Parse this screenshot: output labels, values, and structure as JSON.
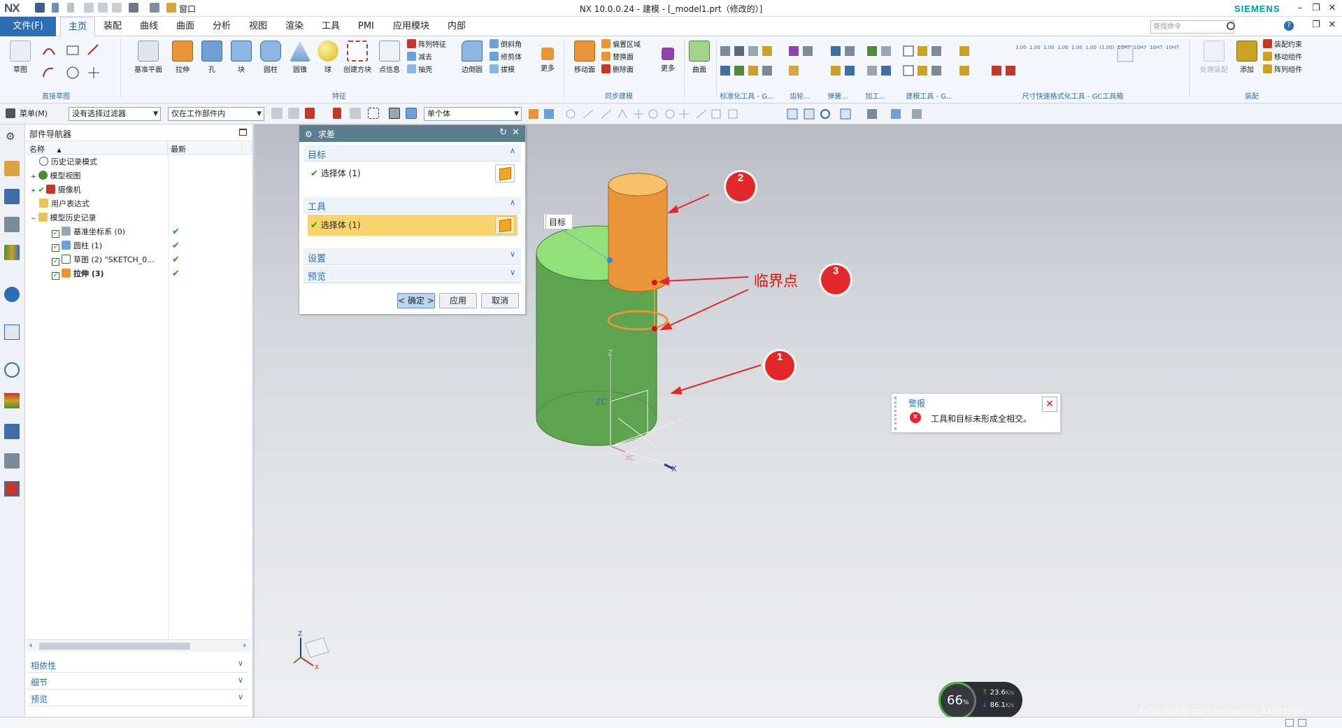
{
  "app": {
    "logo": "NX",
    "title": "NX 10.0.0.24 - 建模 - [_model1.prt（修改的）]",
    "brand": "SIEMENS",
    "window_menu": "窗口"
  },
  "menubar": {
    "file": "文件(F)",
    "tabs": [
      "主页",
      "装配",
      "曲线",
      "曲面",
      "分析",
      "视图",
      "渲染",
      "工具",
      "PMI",
      "应用模块",
      "内部"
    ],
    "search_placeholder": "查找命令"
  },
  "ribbon": {
    "sketch": "草图",
    "datum": "基准平面",
    "extrude": "拉伸",
    "hole": "孔",
    "block": "块",
    "cylinder": "圆柱",
    "cone": "圆锥",
    "sphere": "球",
    "create_box": "创建方块",
    "point_info": "点信息",
    "array_feature": "阵列特征",
    "subtract": "减去",
    "shell": "抽壳",
    "edge_blend": "边倒圆",
    "chamfer": "倒斜角",
    "trim_body": "修剪体",
    "draft": "拔模",
    "more1": "更多",
    "move_face": "移动面",
    "offset_region": "偏置区域",
    "replace_face": "替换面",
    "delete_face": "删除面",
    "more2": "更多",
    "surface": "曲面",
    "group_labels": [
      "直接草图",
      "特征",
      "同步建模",
      "标准化工具 - G...",
      "齿轮...",
      "弹簧...",
      "加工...",
      "建模工具 - G...",
      "尺寸快速格式化工具 - GC工具箱",
      "装配"
    ],
    "asm_constraint": "装配约束",
    "move_component": "移动组件",
    "array_component": "阵列组件",
    "add": "添加",
    "process_asm": "处理装配",
    "dim_labels": [
      "1.00",
      "1.00",
      "1.00",
      "1.00",
      "1.00",
      "1.00",
      "(1.00)",
      "10H7",
      "10H7",
      "10H7",
      "10H7"
    ]
  },
  "cmdbar": {
    "menu": "菜单(M)",
    "filter": "没有选择过滤器",
    "scope": "仅在工作部件内",
    "body": "单个体"
  },
  "navigator": {
    "title": "部件导航器",
    "col_name": "名称",
    "col_latest": "最新",
    "items": [
      {
        "label": "历史记录模式",
        "indent": 1
      },
      {
        "label": "模型视图",
        "indent": 1
      },
      {
        "label": "摄像机",
        "indent": 1
      },
      {
        "label": "用户表达式",
        "indent": 1
      },
      {
        "label": "模型历史记录",
        "indent": 1
      },
      {
        "label": "基准坐标系 (0)",
        "indent": 2,
        "latest": "✔"
      },
      {
        "label": "圆柱 (1)",
        "indent": 2,
        "latest": "✔"
      },
      {
        "label": "草图 (2) \"SKETCH_0...",
        "indent": 2,
        "latest": "✔"
      },
      {
        "label": "拉伸 (3)",
        "indent": 2,
        "latest": "✔"
      }
    ],
    "panels": [
      "相依性",
      "细节",
      "预览"
    ]
  },
  "dialog": {
    "title": "求差",
    "target": "目标",
    "tool": "工具",
    "selected_target": "选择体 (1)",
    "selected_tool": "选择体 (1)",
    "settings": "设置",
    "preview": "预览",
    "ok": "< 确定 >",
    "apply": "应用",
    "cancel": "取消"
  },
  "viewport": {
    "tag_target": "目标",
    "critical_label": "临界点",
    "markers": [
      "1",
      "2",
      "3"
    ],
    "axis_z": "Z",
    "axis_y": "Y",
    "axis_x": "X",
    "axis_zc": "ZC",
    "axis_xc": "XC"
  },
  "alarm": {
    "title": "警报",
    "message": "工具和目标未形成全相交。"
  },
  "speed": {
    "percent": "66",
    "unit": "%",
    "up": "23.6",
    "down": "86.1",
    "rate_unit": "K/s"
  },
  "watermark": "https://blog.csdn.net/weixin_43871798",
  "colors": {
    "accent": "#2e6db4",
    "body_green": "#5ea34f",
    "top_green": "#92e07a",
    "tool_orange": "#e8953a",
    "alert_red": "#e3282c"
  }
}
